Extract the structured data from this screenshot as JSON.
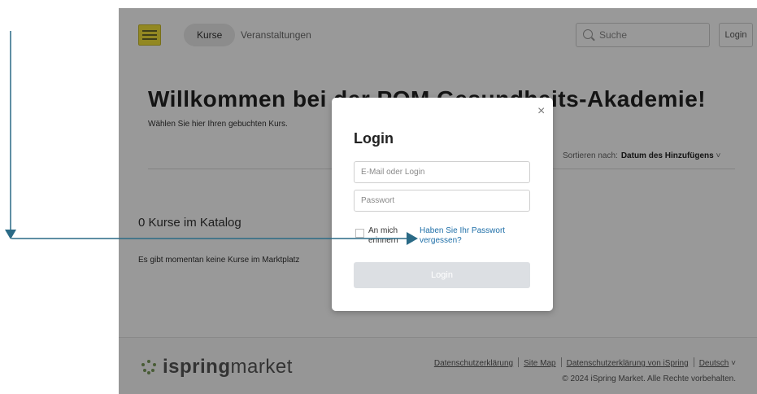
{
  "header": {
    "nav_courses": "Kurse",
    "nav_events": "Veranstaltungen",
    "search_placeholder": "Suche",
    "login_button": "Login"
  },
  "main": {
    "title": "Willkommen bei der POM Gesundheits-Akademie!",
    "subtitle": "Wählen Sie hier Ihren gebuchten Kurs.",
    "sort_label": "Sortieren nach:",
    "sort_value": "Datum des Hinzufügens",
    "catalog_title": "0 Kurse im Katalog",
    "empty_message": "Es gibt momentan keine Kurse im Marktplatz"
  },
  "modal": {
    "title": "Login",
    "close_symbol": "×",
    "email_placeholder": "E-Mail oder Login",
    "password_placeholder": "Passwort",
    "remember_label": "An mich erinnern",
    "forgot_link": "Haben Sie Ihr Passwort vergessen?",
    "submit_label": "Login"
  },
  "footer": {
    "brand_ispring": "ispring",
    "brand_market": "market",
    "links": [
      "Datenschutzerklärung",
      "Site Map",
      "Datenschutzerklärung von iSpring",
      "Deutsch"
    ],
    "copyright": "© 2024 iSpring Market. Alle Rechte vorbehalten."
  },
  "colors": {
    "accent_link": "#1f6fa8",
    "arrow": "#2a6a86",
    "logo_yellow": "#f3e33a"
  }
}
